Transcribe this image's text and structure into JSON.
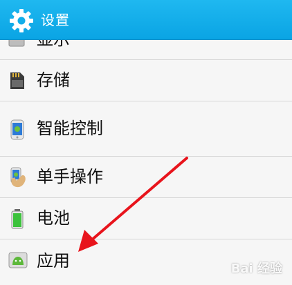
{
  "header": {
    "title": "设置",
    "icon": "gear-icon"
  },
  "items": [
    {
      "label": "显示",
      "icon": "display-icon"
    },
    {
      "label": "存储",
      "icon": "sd-card-icon"
    },
    {
      "label": "智能控制",
      "icon": "phone-android-icon"
    },
    {
      "label": "单手操作",
      "icon": "hand-phone-icon"
    },
    {
      "label": "电池",
      "icon": "battery-icon"
    },
    {
      "label": "应用",
      "icon": "android-app-icon"
    }
  ],
  "watermark": "Bai 经验",
  "colors": {
    "header": "#0aa4e4",
    "arrow": "#e8141c",
    "battery": "#3cc23c"
  }
}
